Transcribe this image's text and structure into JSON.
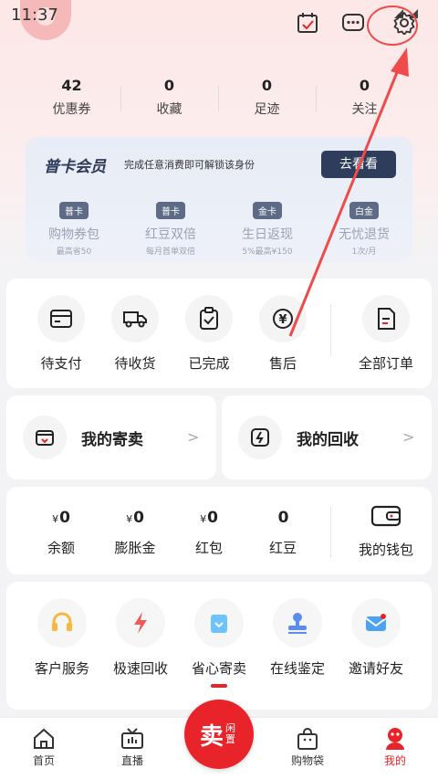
{
  "status": {
    "time": "11:37"
  },
  "stats": [
    {
      "value": "42",
      "label": "优惠券"
    },
    {
      "value": "0",
      "label": "收藏"
    },
    {
      "value": "0",
      "label": "足迹"
    },
    {
      "value": "0",
      "label": "关注"
    }
  ],
  "member": {
    "title": "普卡会员",
    "subtitle": "完成任意消费即可解锁该身份",
    "button": "去看看",
    "benefits": [
      {
        "badge": "普卡",
        "title": "购物券包",
        "desc": "最高省50"
      },
      {
        "badge": "普卡",
        "title": "红豆双倍",
        "desc": "每月首单双倍"
      },
      {
        "badge": "金卡",
        "title": "生日返现",
        "desc": "5%最高¥150"
      },
      {
        "badge": "白金",
        "title": "无忧退货",
        "desc": "1次/月"
      }
    ]
  },
  "orders": [
    {
      "label": "待支付",
      "icon": "wallet-card-icon"
    },
    {
      "label": "待收货",
      "icon": "truck-icon"
    },
    {
      "label": "已完成",
      "icon": "clipboard-check-icon"
    },
    {
      "label": "售后",
      "icon": "yen-refund-icon"
    },
    {
      "label": "全部订单",
      "icon": "order-list-icon"
    }
  ],
  "consign": {
    "title": "我的寄卖"
  },
  "recycle": {
    "title": "我的回收"
  },
  "wallet": {
    "items": [
      {
        "currency": "¥",
        "value": "0",
        "label": "余额"
      },
      {
        "currency": "¥",
        "value": "0",
        "label": "膨胀金"
      },
      {
        "currency": "¥",
        "value": "0",
        "label": "红包"
      },
      {
        "currency": "",
        "value": "0",
        "label": "红豆"
      }
    ],
    "my_wallet": "我的钱包"
  },
  "services": [
    {
      "label": "客户服务",
      "icon": "headset-icon",
      "color": "#f6b73c"
    },
    {
      "label": "极速回收",
      "icon": "lightning-icon",
      "color": "#ef5a5a"
    },
    {
      "label": "省心寄卖",
      "icon": "shopping-bag-icon",
      "color": "#6cc3ff"
    },
    {
      "label": "在线鉴定",
      "icon": "stamp-icon",
      "color": "#5b8def"
    },
    {
      "label": "邀请好友",
      "icon": "invite-mail-icon",
      "color": "#4aa3f5"
    }
  ],
  "tabs": [
    {
      "label": "首页"
    },
    {
      "label": "直播"
    },
    {
      "label": "购物袋"
    },
    {
      "label": "我的"
    }
  ],
  "sell": {
    "main": "卖",
    "sub": "闲置"
  },
  "colors": {
    "accent": "#e8242a",
    "member_dark": "#2f3d5c"
  }
}
